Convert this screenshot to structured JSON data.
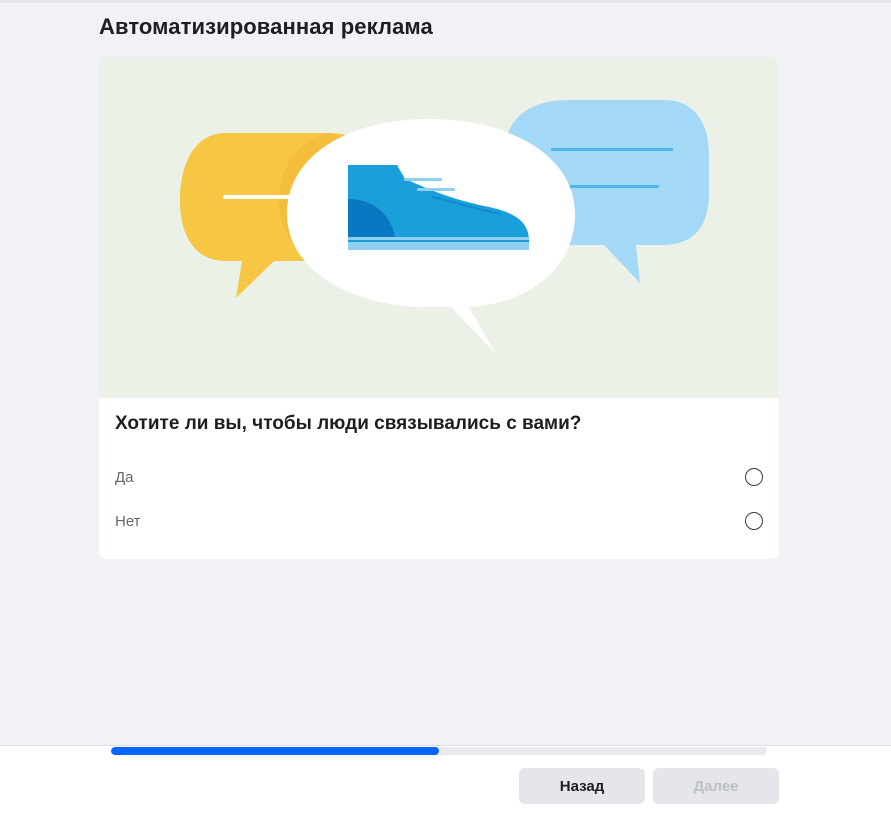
{
  "page": {
    "title": "Автоматизированная реклама"
  },
  "card": {
    "question": "Хотите ли вы, чтобы люди связывались с вами?",
    "options": [
      {
        "label": "Да",
        "selected": false
      },
      {
        "label": "Нет",
        "selected": false
      }
    ]
  },
  "footer": {
    "progress_fraction": 0.5,
    "back_label": "Назад",
    "next_label": "Далее",
    "next_disabled": true
  },
  "colors": {
    "accent": "#0866ff",
    "page_bg": "#f1f2f6",
    "hero_bg": "#ebf1e7",
    "bubble_yellow": "#f7c744",
    "bubble_blue": "#a3d9f7",
    "shoe_blue": "#1a9fdb"
  },
  "icons": {
    "hero": "chat-bubbles-with-shoe-illustration",
    "radio": "radio-unchecked-icon"
  }
}
